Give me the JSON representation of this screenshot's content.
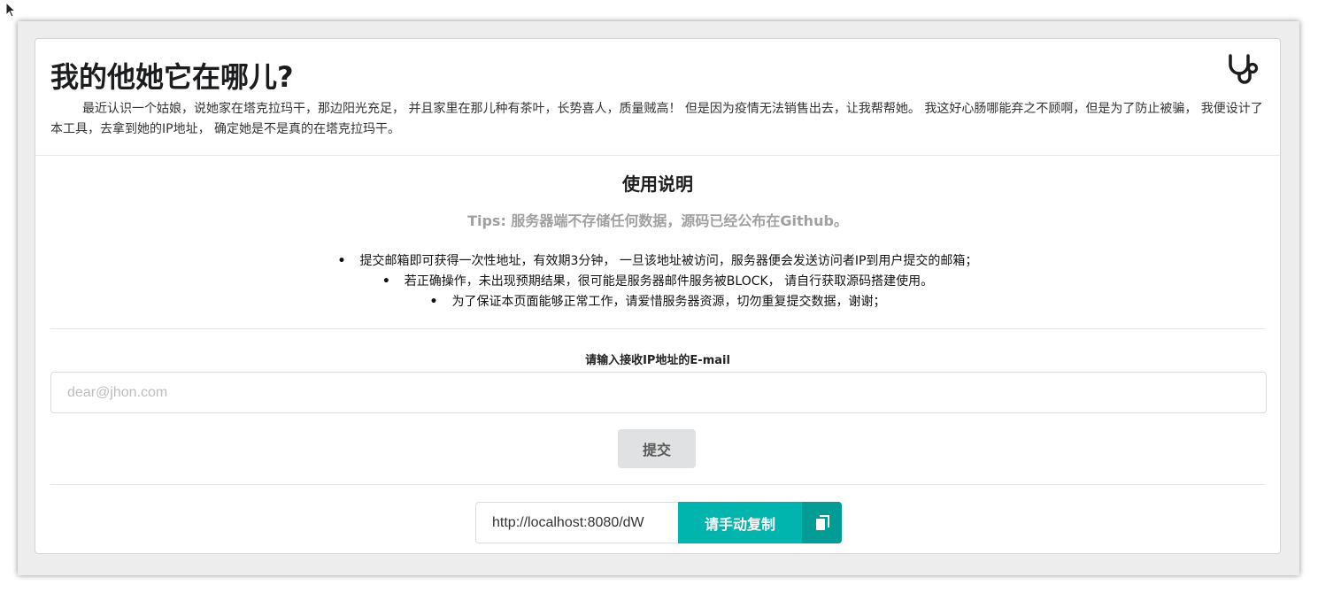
{
  "header": {
    "title": "我的他她它在哪儿?",
    "intro": "最近认识一个姑娘，说她家在塔克拉玛干，那边阳光充足， 并且家里在那儿种有茶叶，长势喜人，质量贼高！ 但是因为疫情无法销售出去，让我帮帮她。 我这好心肠哪能弃之不顾啊，但是为了防止被骗， 我便设计了本工具，去拿到她的IP地址， 确定她是不是真的在塔克拉玛干。",
    "icon": "stethoscope-icon"
  },
  "instructions": {
    "title": "使用说明",
    "tips": "Tips: 服务器端不存储任何数据，源码已经公布在Github。",
    "rules": [
      "提交邮箱即可获得一次性地址，有效期3分钟， 一旦该地址被访问，服务器便会发送访问者IP到用户提交的邮箱；",
      "若正确操作，未出现预期结果，很可能是服务器邮件服务被BLOCK， 请自行获取源码搭建使用。",
      "为了保证本页面能够正常工作，请爱惜服务器资源，切勿重复提交数据，谢谢；"
    ]
  },
  "form": {
    "email_label": "请输入接收IP地址的E-mail",
    "email_placeholder": "dear@jhon.com",
    "submit_label": "提交"
  },
  "result": {
    "url_value": "http://localhost:8080/dW",
    "copy_label": "请手动复制",
    "copy_icon": "copy-icon"
  },
  "colors": {
    "accent": "#00b5ad",
    "accent_dark": "#009c95",
    "submit_bg": "#e0e1e2",
    "tips_text": "#a0a0a0"
  }
}
